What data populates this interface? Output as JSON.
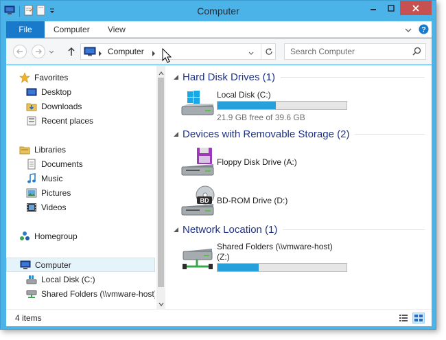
{
  "window": {
    "title": "Computer"
  },
  "ribbon": {
    "tabs": [
      {
        "label": "File"
      },
      {
        "label": "Computer"
      },
      {
        "label": "View"
      }
    ]
  },
  "address": {
    "location": "Computer"
  },
  "search": {
    "placeholder": "Search Computer"
  },
  "nav_pane": {
    "favorites": {
      "label": "Favorites",
      "icon": "star-icon"
    },
    "favorites_items": [
      {
        "label": "Desktop",
        "icon": "desktop-icon"
      },
      {
        "label": "Downloads",
        "icon": "downloads-icon"
      },
      {
        "label": "Recent places",
        "icon": "recent-places-icon"
      }
    ],
    "libraries": {
      "label": "Libraries",
      "icon": "libraries-icon"
    },
    "libraries_items": [
      {
        "label": "Documents",
        "icon": "documents-icon"
      },
      {
        "label": "Music",
        "icon": "music-icon"
      },
      {
        "label": "Pictures",
        "icon": "pictures-icon"
      },
      {
        "label": "Videos",
        "icon": "videos-icon"
      }
    ],
    "homegroup": {
      "label": "Homegroup",
      "icon": "homegroup-icon"
    },
    "computer": {
      "label": "Computer",
      "icon": "computer-icon"
    },
    "computer_items": [
      {
        "label": "Local Disk (C:)",
        "icon": "local-disk-icon"
      },
      {
        "label": "Shared Folders (\\\\vmware-host)",
        "icon": "network-drive-icon"
      }
    ]
  },
  "groups": [
    {
      "title": "Hard Disk Drives (1)",
      "items": [
        {
          "name": "Local Disk (C:)",
          "subtitle": "21.9 GB free of 39.6 GB",
          "used_fraction": 0.45,
          "icon": "windows-drive-icon"
        }
      ]
    },
    {
      "title": "Devices with Removable Storage (2)",
      "items": [
        {
          "name": "Floppy Disk Drive (A:)",
          "icon": "floppy-drive-icon"
        },
        {
          "name": "BD-ROM Drive (D:)",
          "icon": "bd-rom-drive-icon"
        }
      ]
    },
    {
      "title": "Network Location (1)",
      "items": [
        {
          "name": "Shared Folders (\\\\vmware-host)",
          "name_line2": "(Z:)",
          "used_fraction": 0.32,
          "icon": "network-drive-icon"
        }
      ]
    }
  ],
  "status": {
    "item_count": "4 items"
  },
  "colors": {
    "titlebar": "#4cb3e8",
    "file_tab": "#1979ca",
    "close_button": "#c75050",
    "progress_fill": "#26a0da",
    "group_title": "#1e3287"
  }
}
